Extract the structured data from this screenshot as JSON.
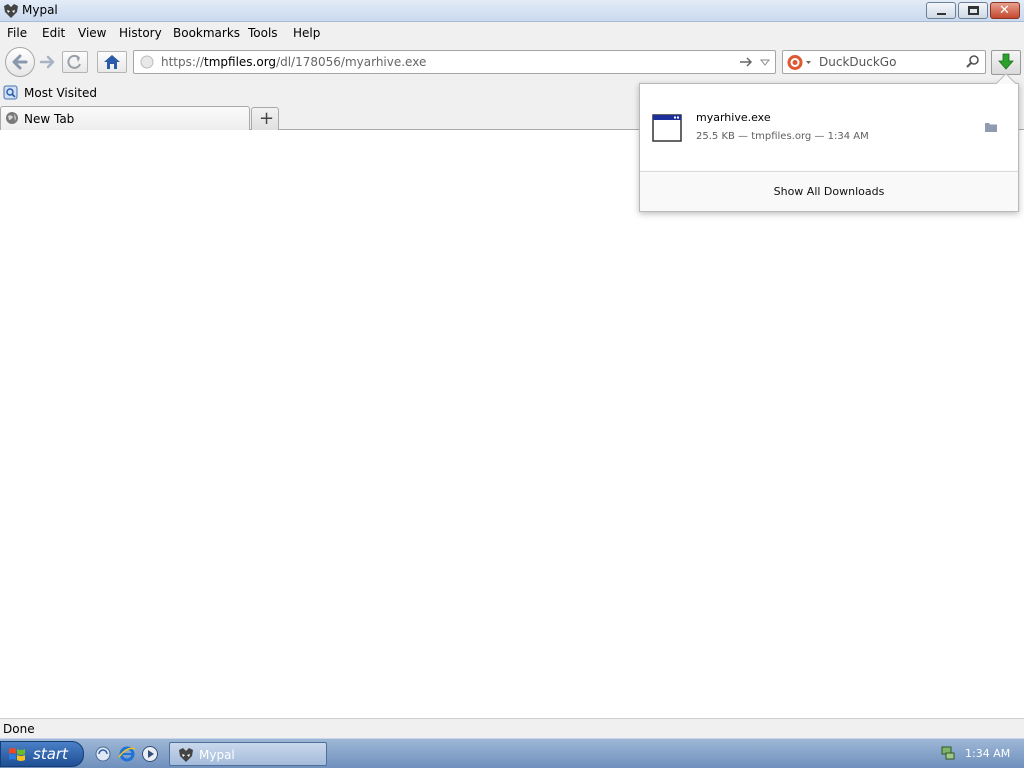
{
  "window": {
    "title": "Mypal"
  },
  "menu": {
    "items": [
      "File",
      "Edit",
      "View",
      "History",
      "Bookmarks",
      "Tools",
      "Help"
    ]
  },
  "navbar": {
    "url_prefix": "https://",
    "url_host": "tmpfiles.org",
    "url_path": "/dl/178056/myarhive.exe",
    "search_placeholder": "DuckDuckGo"
  },
  "bookmarks": {
    "most_visited": "Most Visited"
  },
  "tabs": [
    {
      "label": "New Tab"
    }
  ],
  "downloads": {
    "filename": "myarhive.exe",
    "meta": "25.5 KB — tmpfiles.org — 1:34 AM",
    "show_all": "Show All Downloads"
  },
  "status": {
    "text": "Done"
  },
  "taskbar": {
    "start_label": "start",
    "task_label": "Mypal",
    "clock": "1:34 AM"
  },
  "colors": {
    "download_arrow": "#2aa12a",
    "home_icon": "#2a5aa8",
    "title_gradient_top": "#e3ecf7",
    "taskbar": "#6f90bd"
  }
}
